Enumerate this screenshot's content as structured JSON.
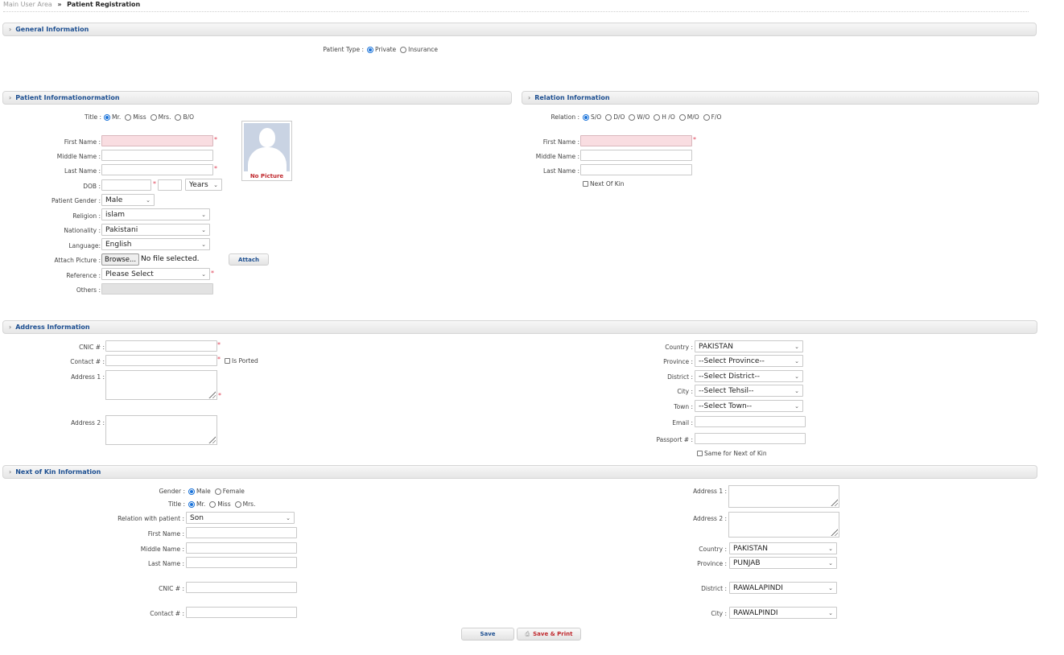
{
  "breadcrumb": {
    "parent": "Main User Area",
    "separator": "»",
    "current": "Patient Registration"
  },
  "sections": {
    "general": "General Information",
    "patient": "Patient Informationormation",
    "relation": "Relation Information",
    "address": "Address Information",
    "kin": "Next of Kin Information"
  },
  "general": {
    "patient_type_label": "Patient Type :",
    "patient_type_options": [
      "Private",
      "Insurance"
    ],
    "patient_type_selected": "Private"
  },
  "patient": {
    "title_label": "Title :",
    "title_options": [
      "Mr.",
      "Miss",
      "Mrs.",
      "B/O"
    ],
    "title_selected": "Mr.",
    "first_name_label": "First Name :",
    "middle_name_label": "Middle Name :",
    "last_name_label": "Last Name :",
    "dob_label": "DOB :",
    "dob_unit": "Years",
    "gender_label": "Patient Gender :",
    "gender_value": "Male",
    "religion_label": "Religion :",
    "religion_value": "islam",
    "nationality_label": "Nationality :",
    "nationality_value": "Pakistani",
    "language_label": "Language:",
    "language_value": "English",
    "attach_picture_label": "Attach Picture :",
    "browse_label": "Browse...",
    "file_status": "No file selected.",
    "attach_button": "Attach",
    "reference_label": "Reference :",
    "reference_value": "Please Select",
    "others_label": "Others :",
    "photo_caption": "No Picture"
  },
  "relation": {
    "relation_label": "Relation :",
    "relation_options": [
      "S/O",
      "D/O",
      "W/O",
      "H /O",
      "M/O",
      "F/O"
    ],
    "relation_selected": "S/O",
    "first_name_label": "First Name :",
    "middle_name_label": "Middle Name :",
    "last_name_label": "Last Name :",
    "next_of_kin_label": "Next Of Kin"
  },
  "address": {
    "cnic_label": "CNIC # :",
    "contact_label": "Contact # :",
    "is_ported_label": "Is Ported",
    "address1_label": "Address 1 :",
    "address2_label": "Address 2 :",
    "country_label": "Country :",
    "country_value": "PAKISTAN",
    "province_label": "Province :",
    "province_value": "--Select Province--",
    "district_label": "District :",
    "district_value": "--Select District--",
    "city_label": "City :",
    "city_value": "--Select Tehsil--",
    "town_label": "Town :",
    "town_value": "--Select Town--",
    "email_label": "Email :",
    "passport_label": "Passport # :",
    "same_for_kin_label": "Same for Next of Kin"
  },
  "kin": {
    "gender_label": "Gender :",
    "gender_options": [
      "Male",
      "Female"
    ],
    "gender_selected": "Male",
    "title_label": "Title :",
    "title_options": [
      "Mr.",
      "Miss",
      "Mrs."
    ],
    "title_selected": "Mr.",
    "relation_label": "Relation with patient :",
    "relation_value": "Son",
    "first_name_label": "First Name :",
    "middle_name_label": "Middle Name :",
    "last_name_label": "Last Name :",
    "cnic_label": "CNIC # :",
    "contact_label": "Contact # :",
    "address1_label": "Address 1 :",
    "address2_label": "Address 2 :",
    "country_label": "Country :",
    "country_value": "PAKISTAN",
    "province_label": "Province :",
    "province_value": "PUNJAB",
    "district_label": "District :",
    "district_value": "RAWALAPINDI",
    "city_label": "City :",
    "city_value": "RAWALPINDI"
  },
  "actions": {
    "save": "Save",
    "save_print": "Save & Print"
  },
  "icons": {
    "section_arrow": "▸",
    "select_chevron": "⌄",
    "printer": "🖶"
  }
}
